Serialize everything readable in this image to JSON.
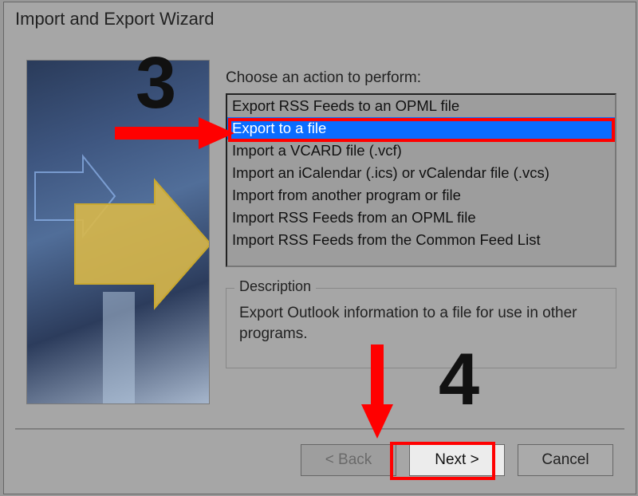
{
  "title": "Import and Export Wizard",
  "prompt": "Choose an action to perform:",
  "actions": [
    "Export RSS Feeds to an OPML file",
    "Export to a file",
    "Import a VCARD file (.vcf)",
    "Import an iCalendar (.ics) or vCalendar file (.vcs)",
    "Import from another program or file",
    "Import RSS Feeds from an OPML file",
    "Import RSS Feeds from the Common Feed List"
  ],
  "selected_index": 1,
  "description": {
    "legend": "Description",
    "text": "Export Outlook information to a file for use in other programs."
  },
  "buttons": {
    "back": "< Back",
    "next": "Next >",
    "cancel": "Cancel"
  },
  "annotations": {
    "step3": "3",
    "step4": "4"
  }
}
